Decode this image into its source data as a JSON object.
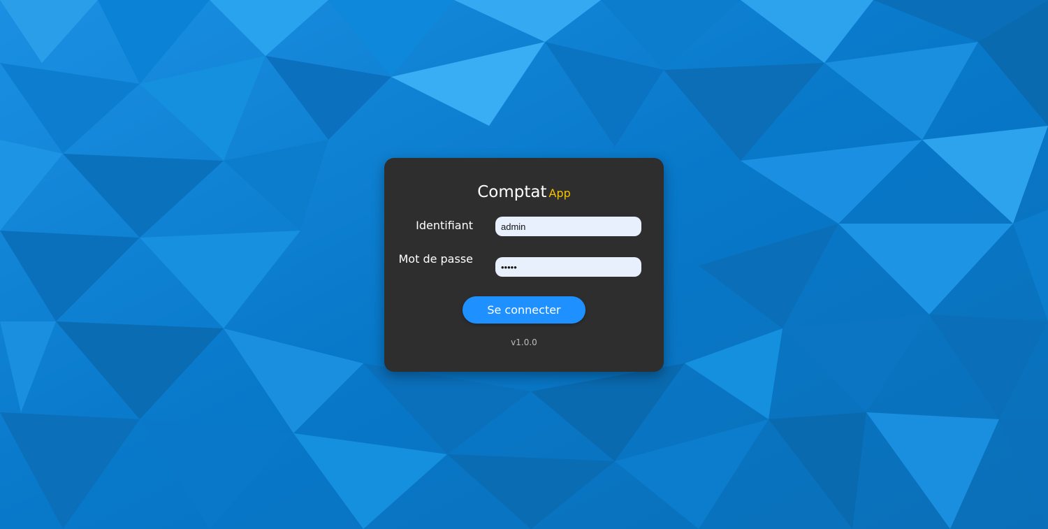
{
  "app": {
    "title": "Comptat",
    "title_accent": "App",
    "version": "v1.0.0"
  },
  "form": {
    "username_label": "Identifiant",
    "username_value": "admin",
    "password_label": "Mot de passe",
    "password_value": "•••••",
    "submit_label": "Se connecter"
  },
  "colors": {
    "background": "#0a7fd3",
    "card": "#2e2e2e",
    "accent": "#f5c400",
    "button": "#1e90ff",
    "input_bg": "#e8f0fe"
  }
}
